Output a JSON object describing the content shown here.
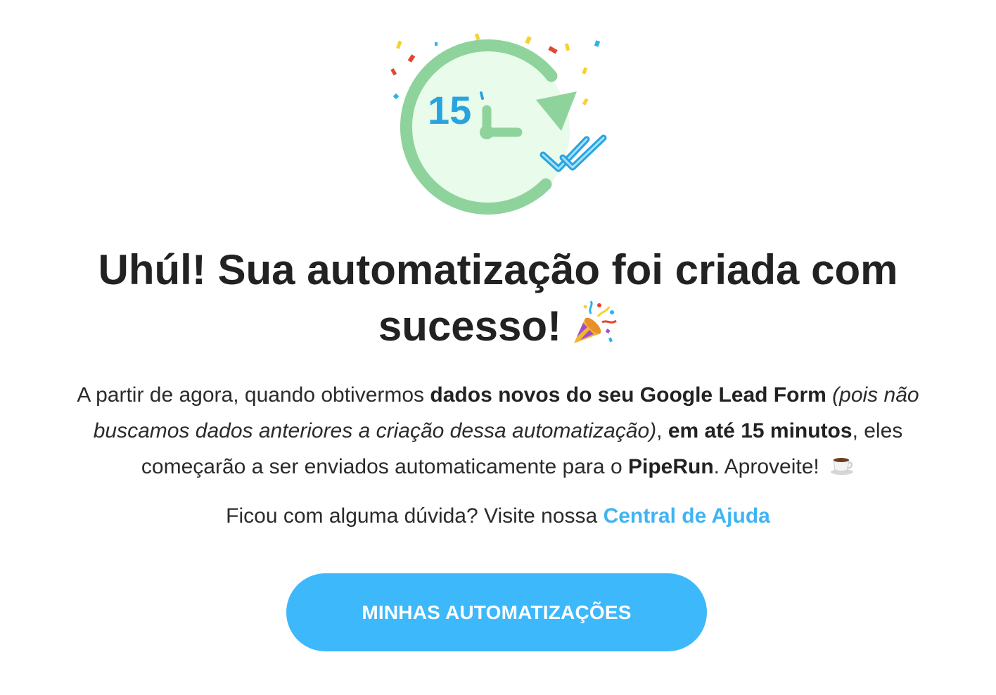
{
  "illustration": {
    "clock_number": "15",
    "colors": {
      "ring": "#8fd39c",
      "fill": "#e9fbeb",
      "accent_blue": "#29a3e0",
      "check_light": "#9fe2ff"
    },
    "confetti_colors": [
      "#f7d12e",
      "#e4452f",
      "#2bb3e8"
    ],
    "icon_names": [
      "clock-refresh-icon",
      "double-check-icon",
      "confetti-icon"
    ]
  },
  "headline": {
    "text": "Uhúl! Sua automatização foi criada com sucesso!",
    "emoji": "party-popper-icon"
  },
  "description": {
    "part1": "A partir de agora, quando obtivermos ",
    "bold1": "dados novos do seu Google Lead Form",
    "italic1": " (pois não buscamos dados anteriores a criação dessa automatização)",
    "part2": ", ",
    "bold2": "em até 15 minutos",
    "part3": ", eles começarão a ser enviados automaticamente para o ",
    "bold3": "PipeRun",
    "part4": ". Aproveite! ",
    "emoji": "coffee-cup-icon"
  },
  "help": {
    "text": "Ficou com alguma dúvida? Visite nossa ",
    "link_label": "Central de Ajuda",
    "link_color": "#3fb4f4"
  },
  "cta": {
    "label": "MINHAS AUTOMATIZAÇÕES",
    "color": "#3db8fb"
  }
}
